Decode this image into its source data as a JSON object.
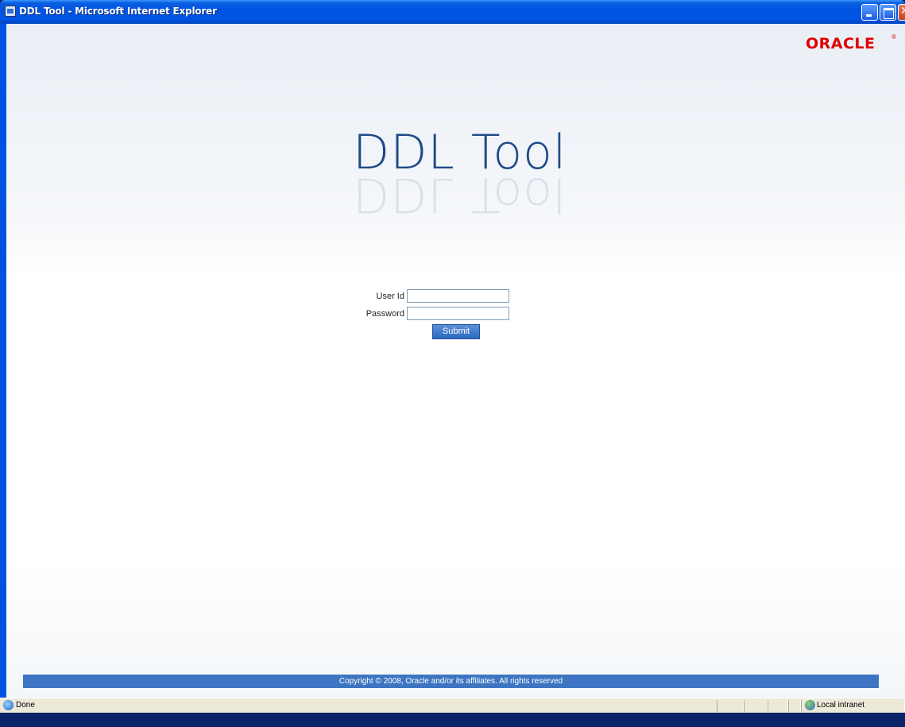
{
  "window": {
    "title": "DDL Tool - Microsoft Internet Explorer"
  },
  "page": {
    "logo_text": "ORACLE",
    "logo_reg": "®",
    "heading": "DDL Tool",
    "form": {
      "user_id_label": "User Id",
      "user_id_value": "",
      "password_label": "Password",
      "password_value": "",
      "submit_label": "Submit"
    },
    "footer": "Copyright © 2008, Oracle and/or its affiliates. All rights reserved"
  },
  "statusbar": {
    "status_text": "Done",
    "zone_text": "Local intranet"
  },
  "icons": {
    "app": "ie-page-icon",
    "status": "ie-page-icon",
    "zone": "local-intranet-icon"
  },
  "colors": {
    "heading": "#1f4a86",
    "logo": "#e00000",
    "footer_bg": "#3d75c2",
    "submit_bg": "#2c6ac2"
  }
}
